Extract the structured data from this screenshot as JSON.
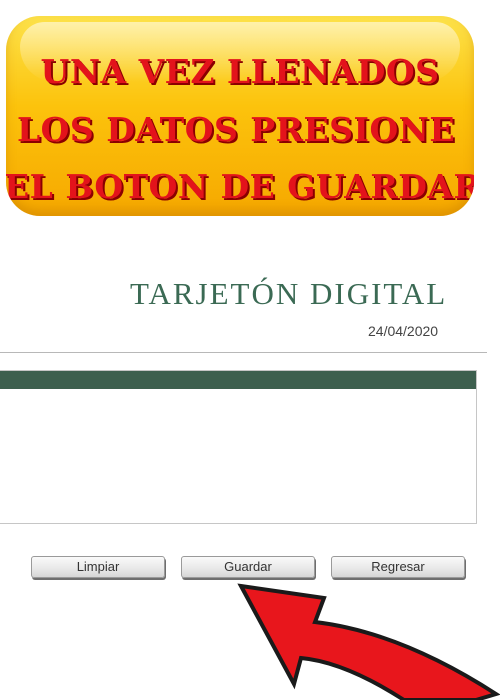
{
  "banner": {
    "line1": "UNA VEZ LLENADOS",
    "line2": "LOS DATOS PRESIONE",
    "line3": "EL BOTON DE GUARDAR"
  },
  "header": {
    "title": "TARJETÓN DIGITAL",
    "date": "24/04/2020"
  },
  "buttons": {
    "clear_label": "Limpiar",
    "save_label": "Guardar",
    "back_label": "Regresar"
  },
  "colors": {
    "banner_text": "#e3131b",
    "banner_fill": "#fcc30c",
    "title": "#3b6a54",
    "panel_header": "#3d5f4e",
    "arrow": "#e8161c"
  },
  "icons": {
    "pointer": "red-arrow-icon"
  }
}
